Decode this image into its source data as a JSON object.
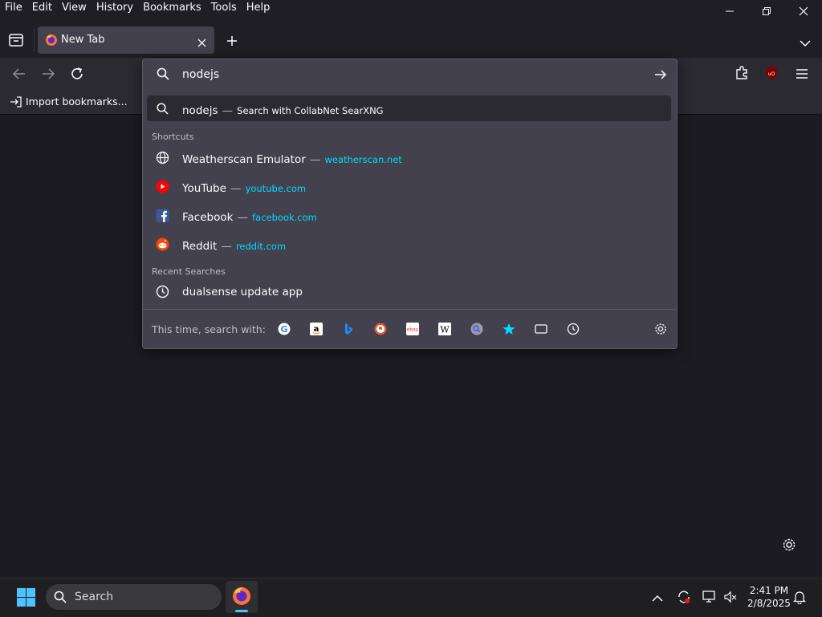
{
  "menu": [
    "File",
    "Edit",
    "View",
    "History",
    "Bookmarks",
    "Tools",
    "Help"
  ],
  "tab": {
    "title": "New Tab"
  },
  "bookmarks": {
    "import_label": "Import bookmarks..."
  },
  "urlbar": {
    "value": "nodejs"
  },
  "suggestion": {
    "query": "nodejs",
    "dash": "—",
    "action": "Search with CollabNet SearXNG"
  },
  "shortcuts_label": "Shortcuts",
  "shortcuts": [
    {
      "title": "Weatherscan Emulator",
      "dash": "—",
      "url": "weatherscan.net",
      "icon": "globe-icon"
    },
    {
      "title": "YouTube",
      "dash": "—",
      "url": "youtube.com",
      "icon": "youtube-icon"
    },
    {
      "title": "Facebook",
      "dash": "—",
      "url": "facebook.com",
      "icon": "facebook-icon"
    },
    {
      "title": "Reddit",
      "dash": "—",
      "url": "reddit.com",
      "icon": "reddit-icon"
    }
  ],
  "recent_label": "Recent Searches",
  "recent": [
    {
      "title": "dualsense update app",
      "icon": "clock-icon"
    }
  ],
  "search_with": {
    "label": "This time, search with:",
    "engines": [
      "google",
      "amazon",
      "bing",
      "duckduckgo",
      "ebay",
      "wikipedia",
      "searxng",
      "bookmarks",
      "tabs",
      "history"
    ]
  },
  "taskbar": {
    "search_placeholder": "Search",
    "time": "2:41 PM",
    "date": "2/8/2025"
  },
  "colors": {
    "accent": "#00ddff",
    "panel": "#42414d",
    "toolbar": "#2b2a33",
    "page": "#1c1b22"
  }
}
